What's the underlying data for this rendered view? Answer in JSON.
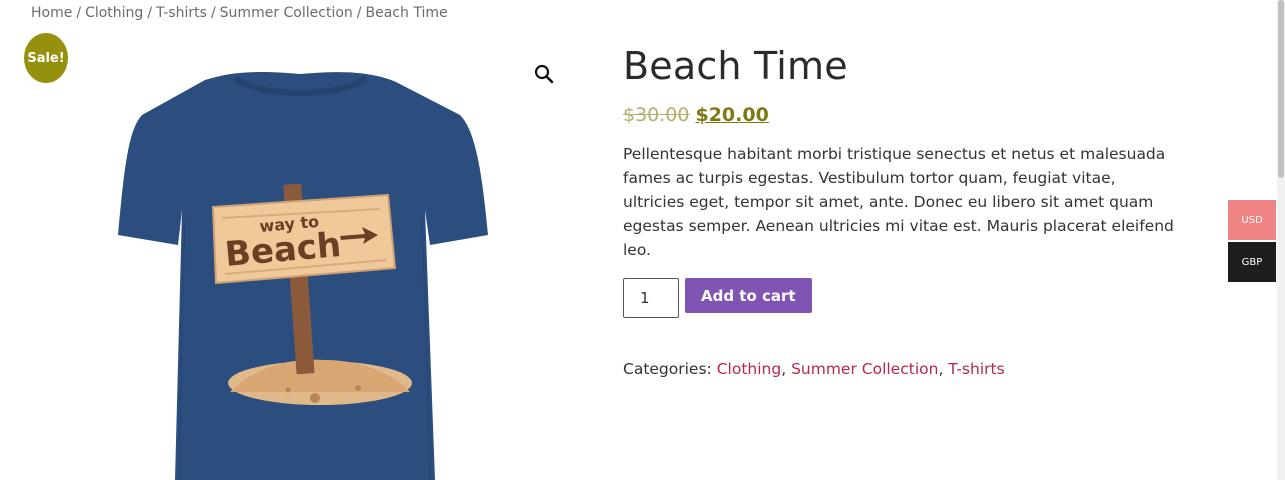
{
  "breadcrumb": {
    "items": [
      "Home",
      "Clothing",
      "T-shirts",
      "Summer Collection"
    ],
    "current": "Beach Time",
    "separator": "/"
  },
  "gallery": {
    "sale_badge": "Sale!",
    "zoom_icon": "search-icon",
    "image_sign_text_small": "way to",
    "image_sign_text_large": "Beach",
    "shirt_color": "#2c4e7e"
  },
  "product": {
    "title": "Beach Time",
    "price_old": "$30.00",
    "price_new": "$20.00",
    "description": "Pellentesque habitant morbi tristique senectus et netus et malesuada fames ac turpis egestas. Vestibulum tortor quam, feugiat vitae, ultricies eget, tempor sit amet, ante. Donec eu libero sit amet quam egestas semper. Aenean ultricies mi vitae est. Mauris placerat eleifend leo.",
    "quantity": "1",
    "add_to_cart_label": "Add to cart",
    "categories_label": "Categories:",
    "categories": [
      "Clothing",
      "Summer Collection",
      "T-shirts"
    ]
  },
  "currency": {
    "options": [
      "USD",
      "GBP"
    ]
  },
  "colors": {
    "accent_button": "#7f54b3",
    "sale_badge": "#96910d",
    "price_new": "#7d7a12",
    "link": "#b8274a",
    "usd_bg": "#f08383",
    "gbp_bg": "#1d1d1d"
  }
}
